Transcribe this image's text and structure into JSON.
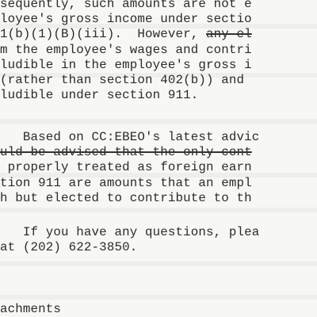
{
  "document": {
    "paragraph1": [
      {
        "segments": [
          {
            "text": "sequently, such amounts are not e",
            "struck": false
          }
        ]
      },
      {
        "segments": [
          {
            "text": "loyee's gross income under sectio",
            "struck": false
          }
        ]
      },
      {
        "segments": [
          {
            "text": "1(b)(1)(B)(iii).  However, ",
            "struck": false
          },
          {
            "text": "any el",
            "struck": true
          }
        ]
      },
      {
        "segments": [
          {
            "text": "m the employee's wages and contri",
            "struck": false
          }
        ]
      },
      {
        "segments": [
          {
            "text": "ludible in the employee's gross i",
            "struck": false
          }
        ]
      },
      {
        "segments": [
          {
            "text": "(rather than section 402(b)) and ",
            "struck": false
          }
        ]
      },
      {
        "segments": [
          {
            "text": "ludible under section 911.",
            "struck": false
          }
        ]
      }
    ],
    "paragraph2": [
      {
        "segments": [
          {
            "text": "   Based on CC:EBEO's latest advic",
            "struck": false
          }
        ]
      },
      {
        "segments": [
          {
            "text": "uld be advised that the only cont",
            "struck": true
          }
        ]
      },
      {
        "segments": [
          {
            "text": " properly treated as foreign earn",
            "struck": false
          }
        ]
      },
      {
        "segments": [
          {
            "text": "tion 911 are amounts that an empl",
            "struck": false
          }
        ]
      },
      {
        "segments": [
          {
            "text": "h but elected to contribute to th",
            "struck": false
          }
        ]
      }
    ],
    "paragraph3": [
      {
        "segments": [
          {
            "text": "   If you have any questions, plea",
            "struck": false
          }
        ]
      },
      {
        "segments": [
          {
            "text": "at (202) 622-3850.",
            "struck": false
          }
        ]
      }
    ],
    "footer": [
      {
        "segments": [
          {
            "text": "achments",
            "struck": false
          }
        ]
      }
    ]
  }
}
